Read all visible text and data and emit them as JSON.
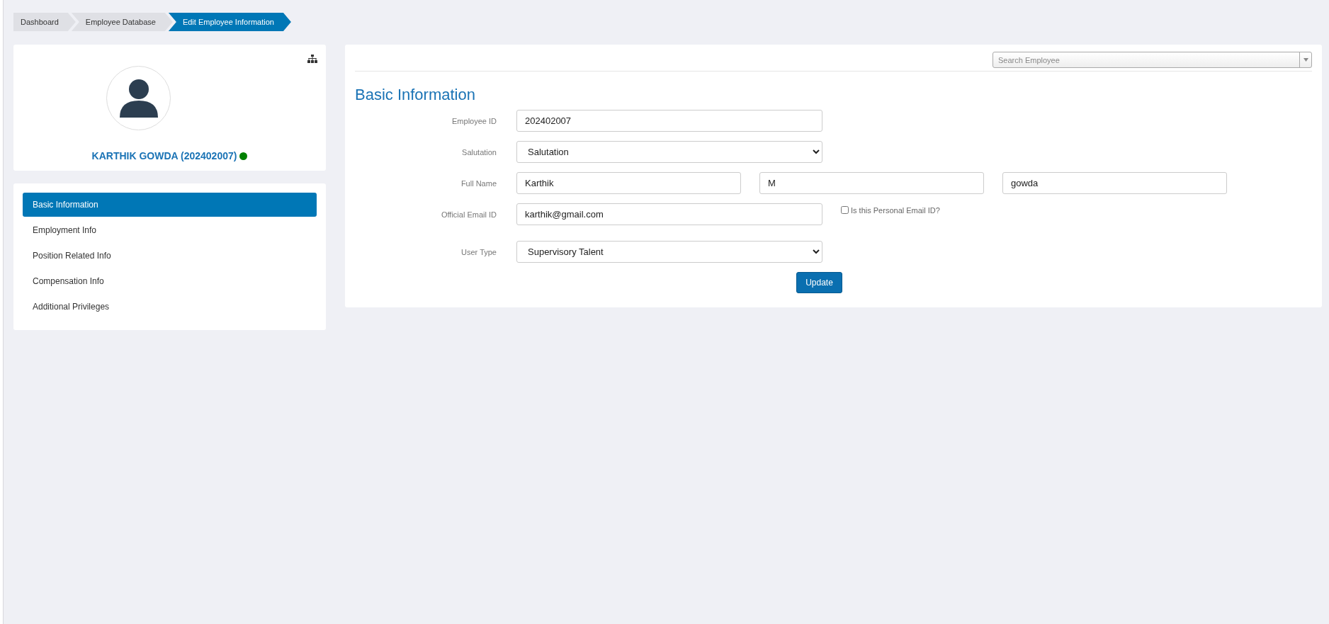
{
  "breadcrumb": [
    {
      "label": "Dashboard",
      "selected": false
    },
    {
      "label": "Employee Database",
      "selected": false
    },
    {
      "label": "Edit Employee Information",
      "selected": true
    }
  ],
  "profile": {
    "name": "KARTHIK GOWDA (202402007)",
    "color": "#008000"
  },
  "sidebar": {
    "items": [
      {
        "label": "Basic Information",
        "selected": true
      },
      {
        "label": "Employment Info",
        "selected": false
      },
      {
        "label": "Position Related Info",
        "selected": false
      },
      {
        "label": "Compensation Info",
        "selected": false
      },
      {
        "label": "Additional Privileges",
        "selected": false
      }
    ]
  },
  "search": {
    "placeholder": "Search Employee"
  },
  "form": {
    "title": "Basic Information",
    "rows": [
      {
        "label": "Employee ID",
        "kind": "input",
        "values": [
          "202402007"
        ]
      },
      {
        "label": "Salutation",
        "kind": "select",
        "values": [
          "Salutation"
        ]
      },
      {
        "label": "Full Name",
        "kind": "triple",
        "values": [
          "Karthik",
          "M",
          "gowda"
        ]
      },
      {
        "label": "Official Email ID",
        "kind": "input",
        "values": [
          "karthik@gmail.com"
        ],
        "checkbox": {
          "label": "Is this Personal Email ID?",
          "checked": false
        }
      },
      {
        "label": "User Type",
        "kind": "select",
        "values": [
          "Supervisory Talent"
        ]
      }
    ],
    "button": "Update"
  }
}
